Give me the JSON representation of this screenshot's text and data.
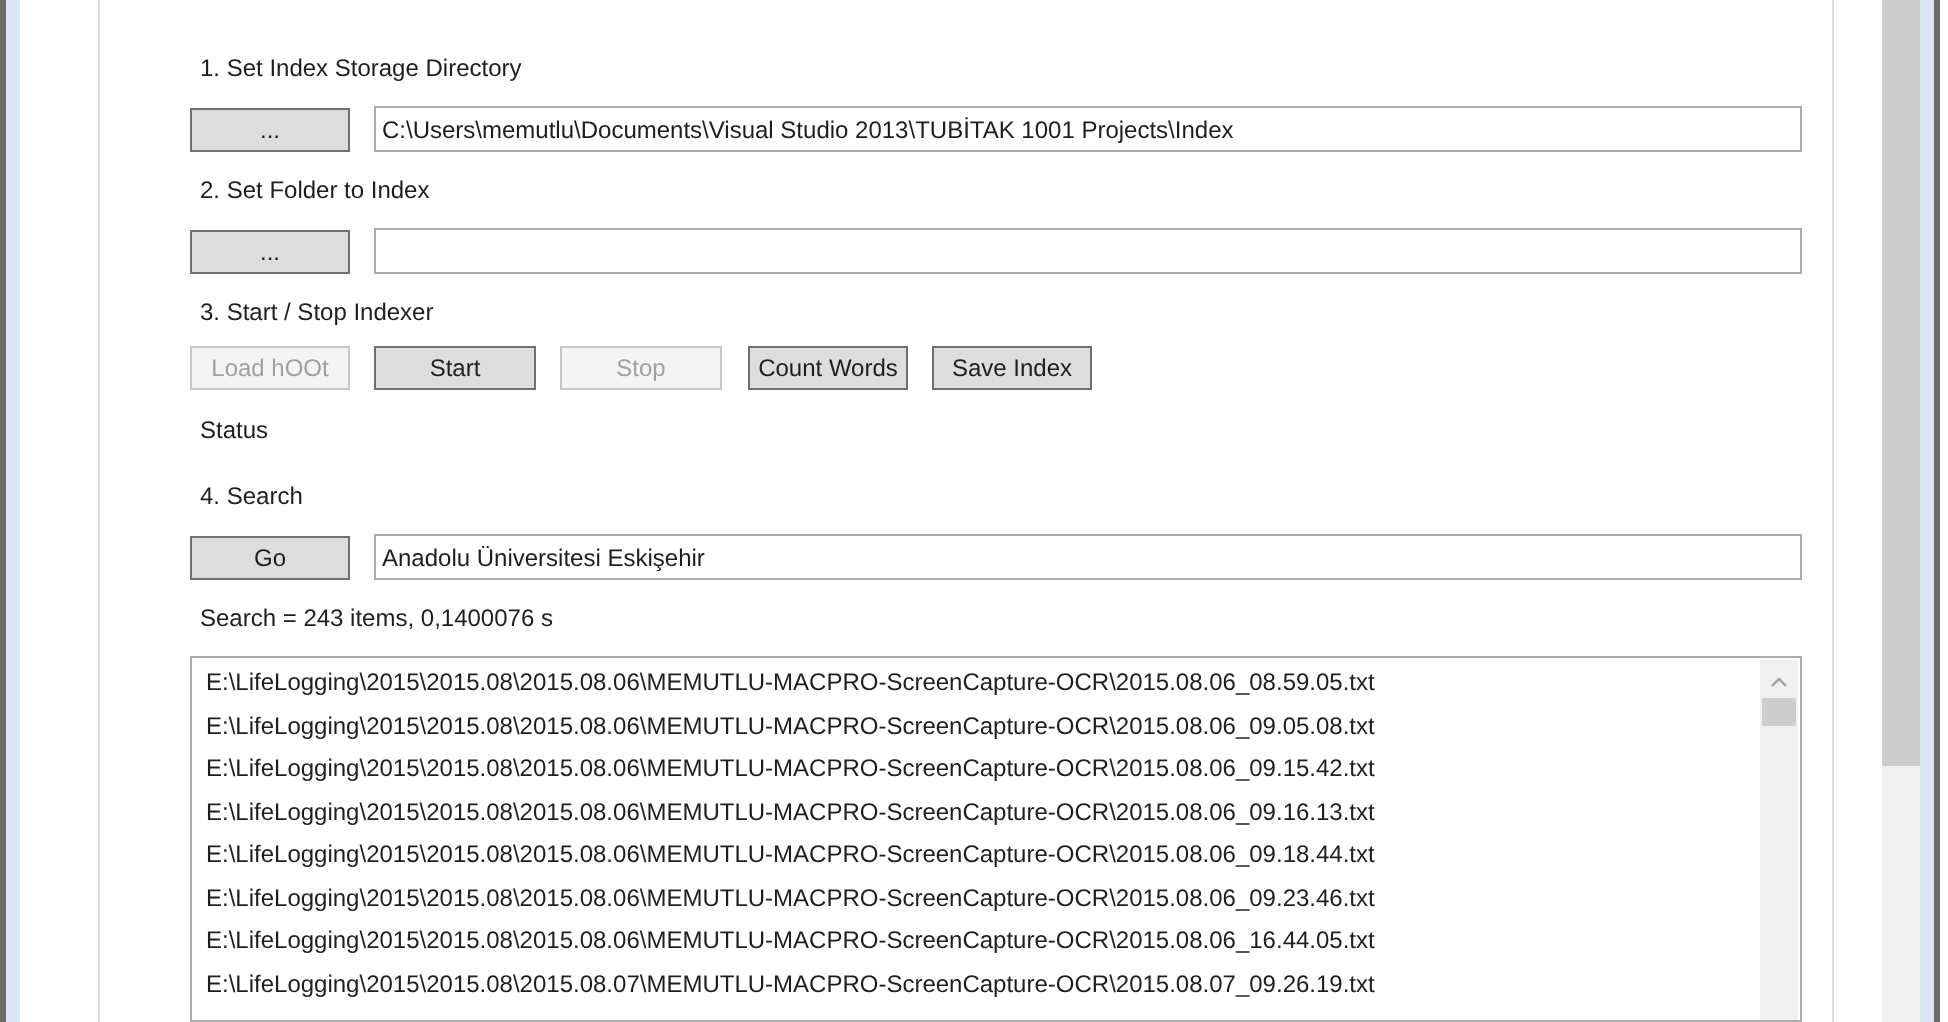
{
  "steps": [
    {
      "label": "1. Set Index Storage Directory",
      "button": {
        "label": "...",
        "disabled": false
      },
      "field": {
        "value": "C:\\Users\\memutlu\\Documents\\Visual Studio 2013\\TUBİTAK 1001 Projects\\Index"
      }
    },
    {
      "label": "2. Set Folder to Index",
      "button": {
        "label": "...",
        "disabled": false
      }
    }
  ],
  "indexer": {
    "label": "3. Start / Stop Indexer",
    "buttons": [
      {
        "label": "Load hOOt",
        "disabled": true
      },
      {
        "label": "Start",
        "disabled": false
      },
      {
        "label": "Stop",
        "disabled": true
      },
      {
        "label": "Count Words",
        "disabled": false
      },
      {
        "label": "Save Index",
        "disabled": false
      }
    ],
    "status": "Status"
  },
  "search": {
    "label": "4. Search",
    "button": {
      "label": "Go",
      "disabled": false
    },
    "field": {
      "value": "Anadolu Üniversitesi Eskişehir"
    },
    "summary": "Search = 243 items, 0,1400076 s"
  },
  "results": [
    "E:\\LifeLogging\\2015\\2015.08\\2015.08.06\\MEMUTLU-MACPRO-ScreenCapture-OCR\\2015.08.06_08.59.05.txt",
    "E:\\LifeLogging\\2015\\2015.08\\2015.08.06\\MEMUTLU-MACPRO-ScreenCapture-OCR\\2015.08.06_09.05.08.txt",
    "E:\\LifeLogging\\2015\\2015.08\\2015.08.06\\MEMUTLU-MACPRO-ScreenCapture-OCR\\2015.08.06_09.15.42.txt",
    "E:\\LifeLogging\\2015\\2015.08\\2015.08.06\\MEMUTLU-MACPRO-ScreenCapture-OCR\\2015.08.06_09.16.13.txt",
    "E:\\LifeLogging\\2015\\2015.08\\2015.08.06\\MEMUTLU-MACPRO-ScreenCapture-OCR\\2015.08.06_09.18.44.txt",
    "E:\\LifeLogging\\2015\\2015.08\\2015.08.06\\MEMUTLU-MACPRO-ScreenCapture-OCR\\2015.08.06_09.23.46.txt",
    "E:\\LifeLogging\\2015\\2015.08\\2015.08.06\\MEMUTLU-MACPRO-ScreenCapture-OCR\\2015.08.06_16.44.05.txt",
    "E:\\LifeLogging\\2015\\2015.08\\2015.08.07\\MEMUTLU-MACPRO-ScreenCapture-OCR\\2015.08.07_09.26.19.txt"
  ]
}
